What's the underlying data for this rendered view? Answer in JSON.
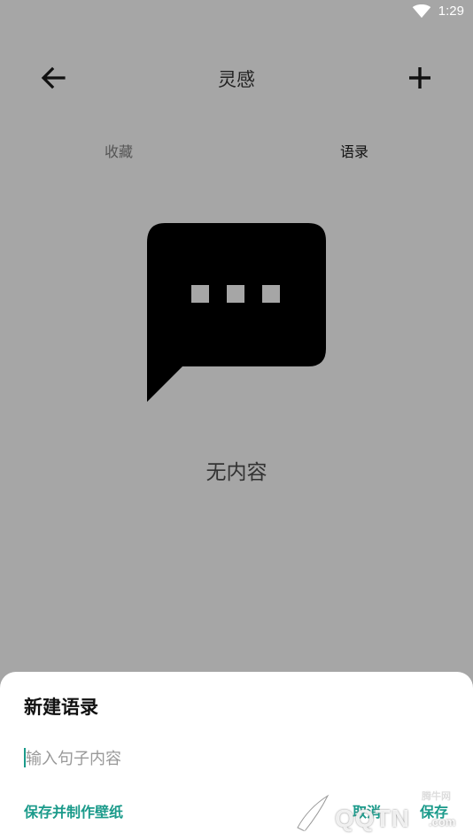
{
  "status_bar": {
    "time": "1:29"
  },
  "app_bar": {
    "title": "灵感"
  },
  "tabs": [
    {
      "label": "收藏"
    },
    {
      "label": "语录"
    }
  ],
  "empty_state": {
    "text": "无内容"
  },
  "new_quote_sheet": {
    "title": "新建语录",
    "input_placeholder": "输入句子内容",
    "save_wallpaper_label": "保存并制作壁纸",
    "cancel_label": "取消",
    "save_label": "保存"
  },
  "watermark": {
    "brand": "QQTN",
    "domain": ".com",
    "small": "腾牛网"
  },
  "colors": {
    "accent": "#1a9a8a",
    "overlay": "#a6a6a6"
  }
}
